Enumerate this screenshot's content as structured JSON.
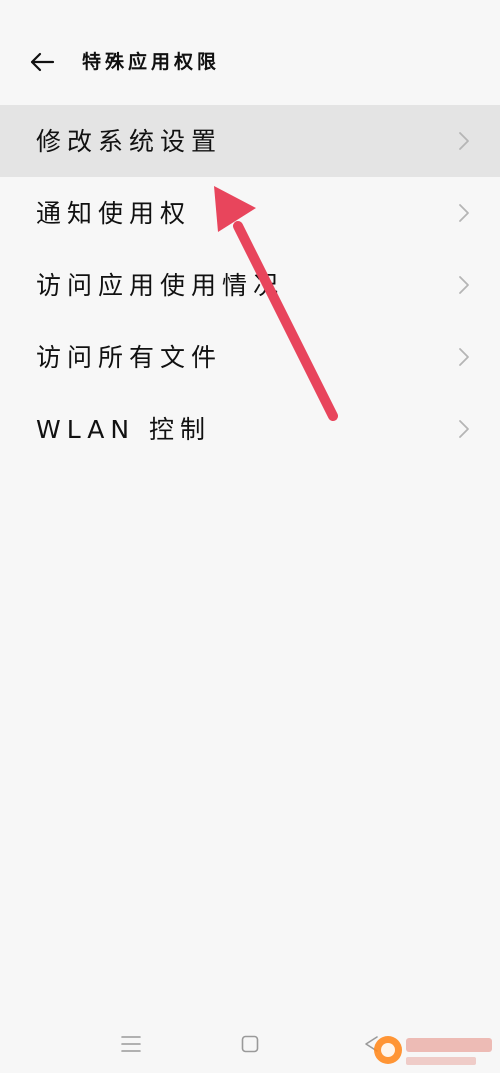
{
  "header": {
    "title": "特殊应用权限",
    "back_icon": "arrow-left-icon"
  },
  "list": {
    "items": [
      {
        "label": "修改系统设置",
        "selected": true,
        "icon": "chevron-right-icon"
      },
      {
        "label": "通知使用权",
        "selected": false,
        "icon": "chevron-right-icon"
      },
      {
        "label": "访问应用使用情况",
        "selected": false,
        "icon": "chevron-right-icon"
      },
      {
        "label": "访问所有文件",
        "selected": false,
        "icon": "chevron-right-icon"
      },
      {
        "label": "WLAN 控制",
        "selected": false,
        "icon": "chevron-right-icon"
      }
    ]
  },
  "navbar": {
    "menu_icon": "menu-icon",
    "home_icon": "home-square-icon",
    "back_icon": "back-triangle-icon"
  },
  "colors": {
    "background": "#f7f7f7",
    "selected_row": "#e4e4e4",
    "chevron": "#b5b5b5",
    "annotation_arrow": "#e8455c"
  }
}
